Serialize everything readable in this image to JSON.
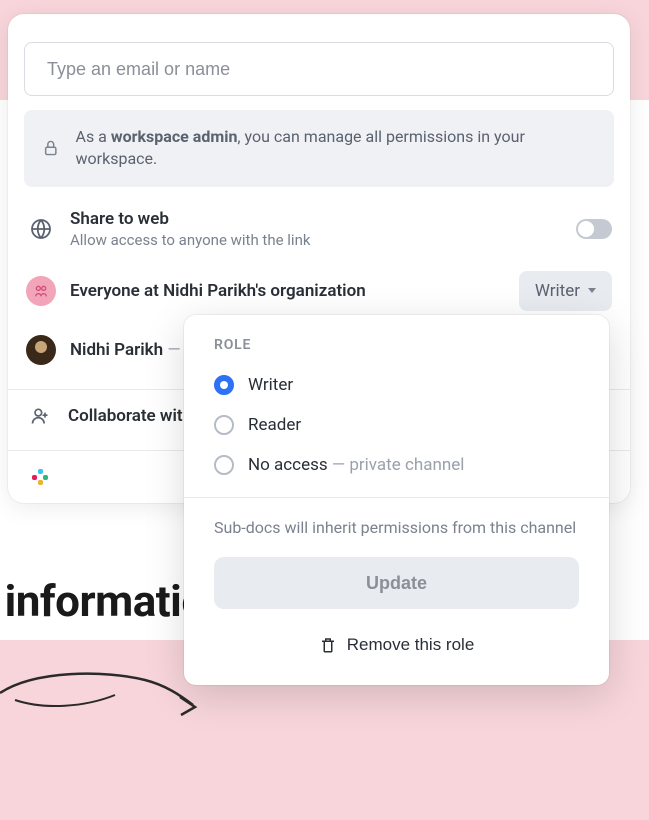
{
  "background": {
    "heading_fragment": "al information"
  },
  "share_panel": {
    "email_placeholder": "Type an email or name",
    "admin_notice_prefix": "As a ",
    "admin_notice_bold": "workspace admin",
    "admin_notice_suffix": ", you can manage all permissions in your workspace.",
    "share_web": {
      "title": "Share to web",
      "subtitle": "Allow access to anyone with the link",
      "enabled": false
    },
    "members": {
      "org": {
        "label": "Everyone at Nidhi Parikh's organization",
        "role": "Writer"
      },
      "user": {
        "name": "Nidhi Parikh",
        "suffix": "—"
      }
    },
    "collaborate_label": "Collaborate wit"
  },
  "role_dropdown": {
    "section_label": "ROLE",
    "options": [
      {
        "label": "Writer",
        "checked": true
      },
      {
        "label": "Reader",
        "checked": false
      },
      {
        "label": "No access",
        "suffix": " — private channel",
        "checked": false
      }
    ],
    "inherit_note": "Sub-docs will inherit permissions from this channel",
    "update_label": "Update",
    "remove_label": "Remove this role"
  }
}
